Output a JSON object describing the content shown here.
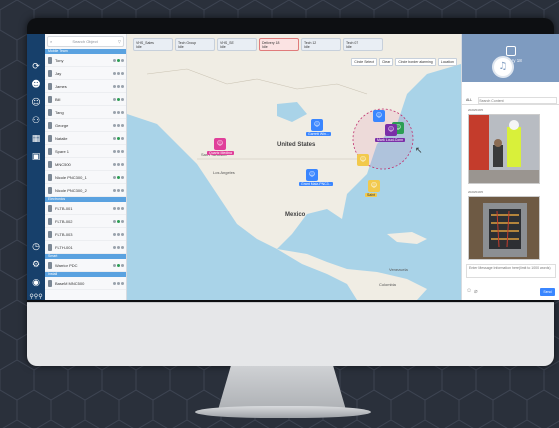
{
  "object_list": {
    "search_placeholder": "Search Object",
    "group_1": "Mobile Team",
    "group_2": "Electronics",
    "group_3": "Smart",
    "group_4": "Install",
    "items": [
      "Tony",
      "Jay",
      "James",
      "Bill",
      "Tang",
      "George",
      "Natalie",
      "Spare 1",
      "MNC500",
      "Nicole PNC300_1",
      "Nicole PNC300_2",
      "FLTB-001",
      "FLTB-002",
      "FLTB-003",
      "FLTH-001",
      "Warrior PDC",
      "BaseM MNC500"
    ]
  },
  "tabs": [
    "VHS_Sales",
    "Tech Group",
    "VHS_SE",
    "Delivery 18",
    "Tech 12",
    "Tech 07"
  ],
  "tab_subtitle": "Idle",
  "map_tools": [
    "Circle Select",
    "Clear",
    "Circle border alarming",
    "Location"
  ],
  "places": {
    "us": "United States",
    "mexico": "Mexico",
    "venezuela": "Venezuela",
    "colombia": "Colombia",
    "los_angeles": "Los Angeles",
    "san_francisco": "San Francisco"
  },
  "markers": {
    "m1": "Quartz Medina",
    "m2": "Garrett Win...",
    "m3": "Mark Loud-Conn",
    "m4": "Grant Maiz-PNC3..",
    "m5": "Saint"
  },
  "chat": {
    "title": "Delivery 18",
    "tab_all": "ALL",
    "search_placeholder": "Search Content",
    "ts1": "2020/04/05",
    "ts2": "2020/04/05",
    "input_placeholder": "Enter Message Information here(limit to 1000 words)",
    "send": "Send"
  },
  "colors": {
    "nav": "#17406b",
    "accent": "#3a86ff",
    "map_water": "#a9d3e8",
    "land": "#f0ede4"
  }
}
